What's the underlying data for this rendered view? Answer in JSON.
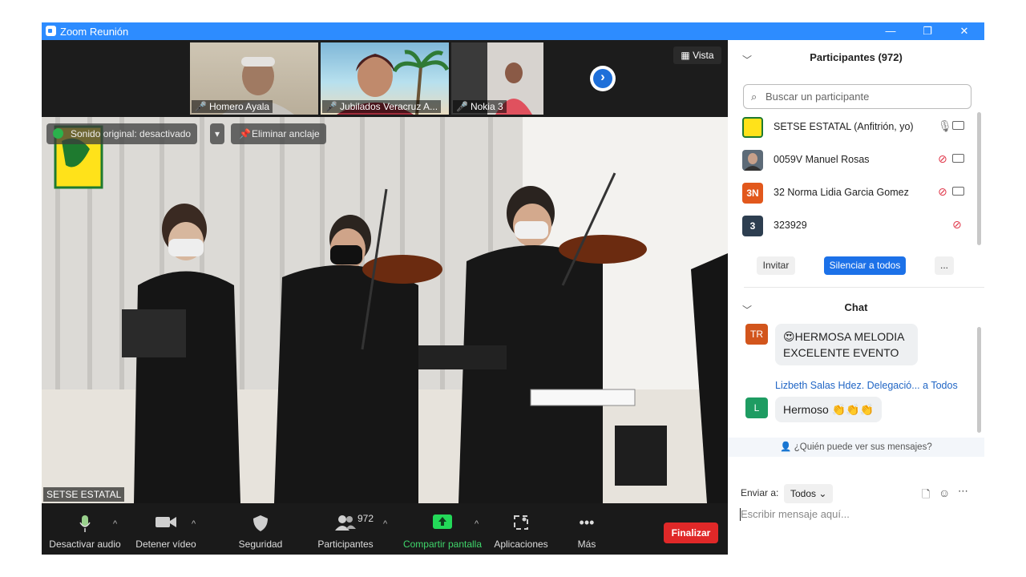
{
  "window": {
    "title": "Zoom Reunión",
    "min": "—",
    "restore": "❐",
    "close": "✕"
  },
  "thumbs": [
    {
      "name": "Homero Ayala"
    },
    {
      "name": "Jubilados Veracruz A..."
    },
    {
      "name": "Nokia 3"
    }
  ],
  "view_label": "Vista",
  "video": {
    "audio_label": "Sonido original: desactivado",
    "unpin_label": "Eliminar anclaje",
    "speaker_name": "SETSE ESTATAL"
  },
  "toolbar": {
    "mute": "Desactivar audio",
    "video": "Detener vídeo",
    "security": "Seguridad",
    "participants": "Participantes",
    "participants_count": "972",
    "share": "Compartir pantalla",
    "apps": "Aplicaciones",
    "more": "Más",
    "end": "Finalizar"
  },
  "participants_panel": {
    "title": "Participantes (972)",
    "search_placeholder": "Buscar un participante",
    "list": [
      {
        "name": "SETSE ESTATAL (Anfitrión, yo)",
        "avatar": ""
      },
      {
        "name": "0059V Manuel Rosas",
        "avatar": ""
      },
      {
        "name": "32 Norma Lidia Garcia Gomez",
        "avatar": "3N"
      },
      {
        "name": "323929",
        "avatar": "3"
      }
    ],
    "invite": "Invitar",
    "mute_all": "Silenciar a todos",
    "more": "..."
  },
  "chat": {
    "title": "Chat",
    "messages": [
      {
        "avatar": "TR",
        "line1": "😍HERMOSA MELODIA",
        "line2": "EXCELENTE EVENTO"
      },
      {
        "avatar": "L",
        "sender": "Lizbeth Salas Hdez. Delegació...",
        "to": "a Todos",
        "text": "Hermoso 👏👏👏"
      }
    ],
    "who_can_see": "¿Quién puede ver sus mensajes?",
    "send_to_label": "Enviar a:",
    "send_to_value": "Todos",
    "input_placeholder": "Escribir mensaje aquí..."
  }
}
